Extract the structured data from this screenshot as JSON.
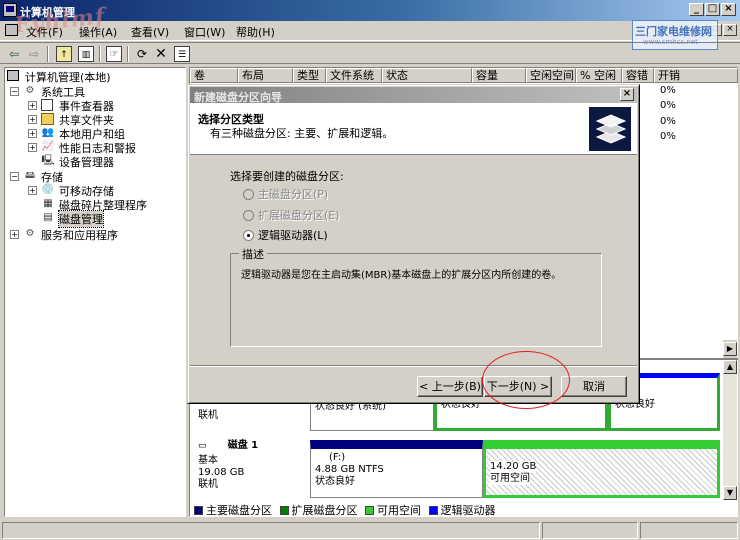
{
  "window": {
    "title": "计算机管理",
    "signature": "Fyhlmf"
  },
  "menubar": [
    "文件(F)",
    "操作(A)",
    "查看(V)",
    "窗口(W)",
    "帮助(H)"
  ],
  "watermark": {
    "line1": "三门家电维修网",
    "line2": "www.smhcs.net"
  },
  "tree": {
    "root": "计算机管理(本地)",
    "system_tools": "系统工具",
    "event_viewer": "事件查看器",
    "shared_folders": "共享文件夹",
    "local_users": "本地用户和组",
    "perf_logs": "性能日志和警报",
    "device_manager": "设备管理器",
    "storage": "存储",
    "removable": "可移动存储",
    "defrag": "磁盘碎片整理程序",
    "disk_mgmt": "磁盘管理",
    "services": "服务和应用程序"
  },
  "columns": [
    "卷",
    "布局",
    "类型",
    "文件系统",
    "状态",
    "容量",
    "空闲空间",
    "% 空闲",
    "容错",
    "开销"
  ],
  "percent_rows": [
    "0%",
    "0%",
    "0%",
    "0%"
  ],
  "disks": {
    "disk0_type": "联机",
    "disk0_parts": [
      {
        "status": "状态良好 (系统)"
      },
      {
        "status": "状态良好"
      },
      {
        "status": "状态良好"
      }
    ],
    "disk1": {
      "name": "磁盘 1",
      "type": "基本",
      "size": "19.08 GB",
      "state": "联机",
      "p1_label": "(F:)",
      "p1_info": "4.88 GB NTFS",
      "p1_status": "状态良好",
      "p2_size": "14.20 GB",
      "p2_status": "可用空间"
    }
  },
  "legend": [
    {
      "label": "主要磁盘分区",
      "color": "#000080"
    },
    {
      "label": "扩展磁盘分区",
      "color": "#008000"
    },
    {
      "label": "可用空间",
      "color": "#33cc33"
    },
    {
      "label": "逻辑驱动器",
      "color": "#0000ff"
    }
  ],
  "dialog": {
    "title": "新建磁盘分区向导",
    "heading": "选择分区类型",
    "subheading": "有三种磁盘分区: 主要、扩展和逻辑。",
    "prompt": "选择要创建的磁盘分区:",
    "options": [
      "主磁盘分区(P)",
      "扩展磁盘分区(E)",
      "逻辑驱动器(L)"
    ],
    "selected": 2,
    "desc_label": "描述",
    "desc_text": "逻辑驱动器是您在主启动集(MBR)基本磁盘上的扩展分区内所创建的卷。",
    "back": "< 上一步(B)",
    "next": "下一步(N) >",
    "cancel": "取消"
  }
}
